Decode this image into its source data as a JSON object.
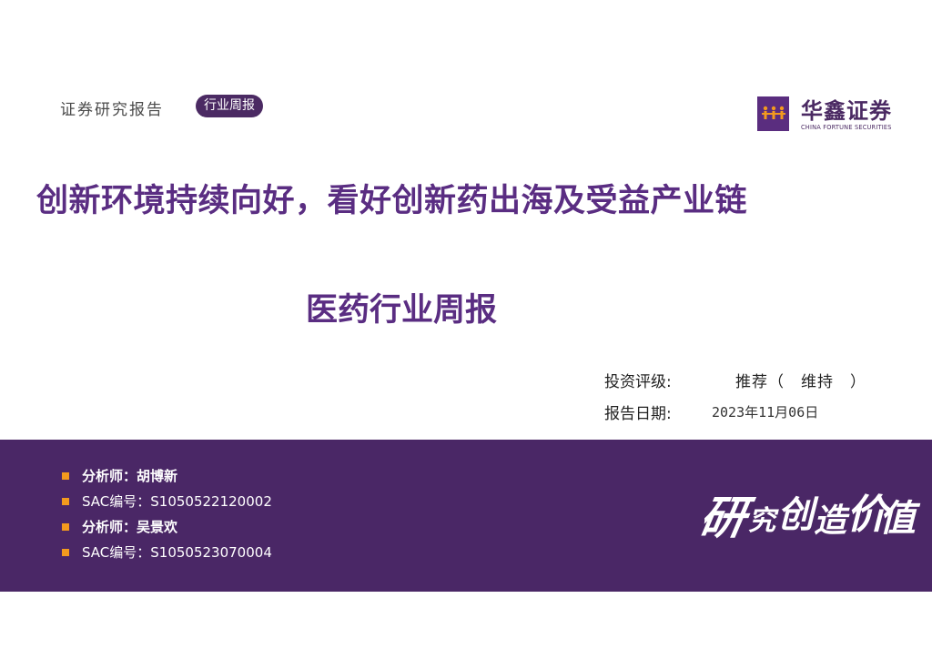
{
  "header": {
    "label": "证券研究报告",
    "tag": "行业周报"
  },
  "logo": {
    "name": "华鑫证券",
    "english": "CHINA FORTUNE SECURITIES",
    "color": "#5a2d7f"
  },
  "title": {
    "main": "创新环境持续向好，看好创新药出海及受益产业链",
    "sub": "医药行业周报"
  },
  "meta": {
    "rating_label": "投资评级:",
    "rating_value": "推荐（　维持　）",
    "date_label": "报告日期:",
    "date_value": "2023年11月06日"
  },
  "analysts": [
    {
      "text": "分析师：胡博新"
    },
    {
      "text": "SAC编号：S1050522120002"
    },
    {
      "text": "分析师：吴景欢"
    },
    {
      "text": "SAC编号：S1050523070004"
    }
  ],
  "slogan": {
    "glyphs": [
      "研",
      "究",
      "创",
      "造",
      "价",
      "值"
    ]
  },
  "colors": {
    "brand_purple": "#4a2766",
    "title_purple": "#5a2d82",
    "bullet_orange": "#f39a1e"
  }
}
